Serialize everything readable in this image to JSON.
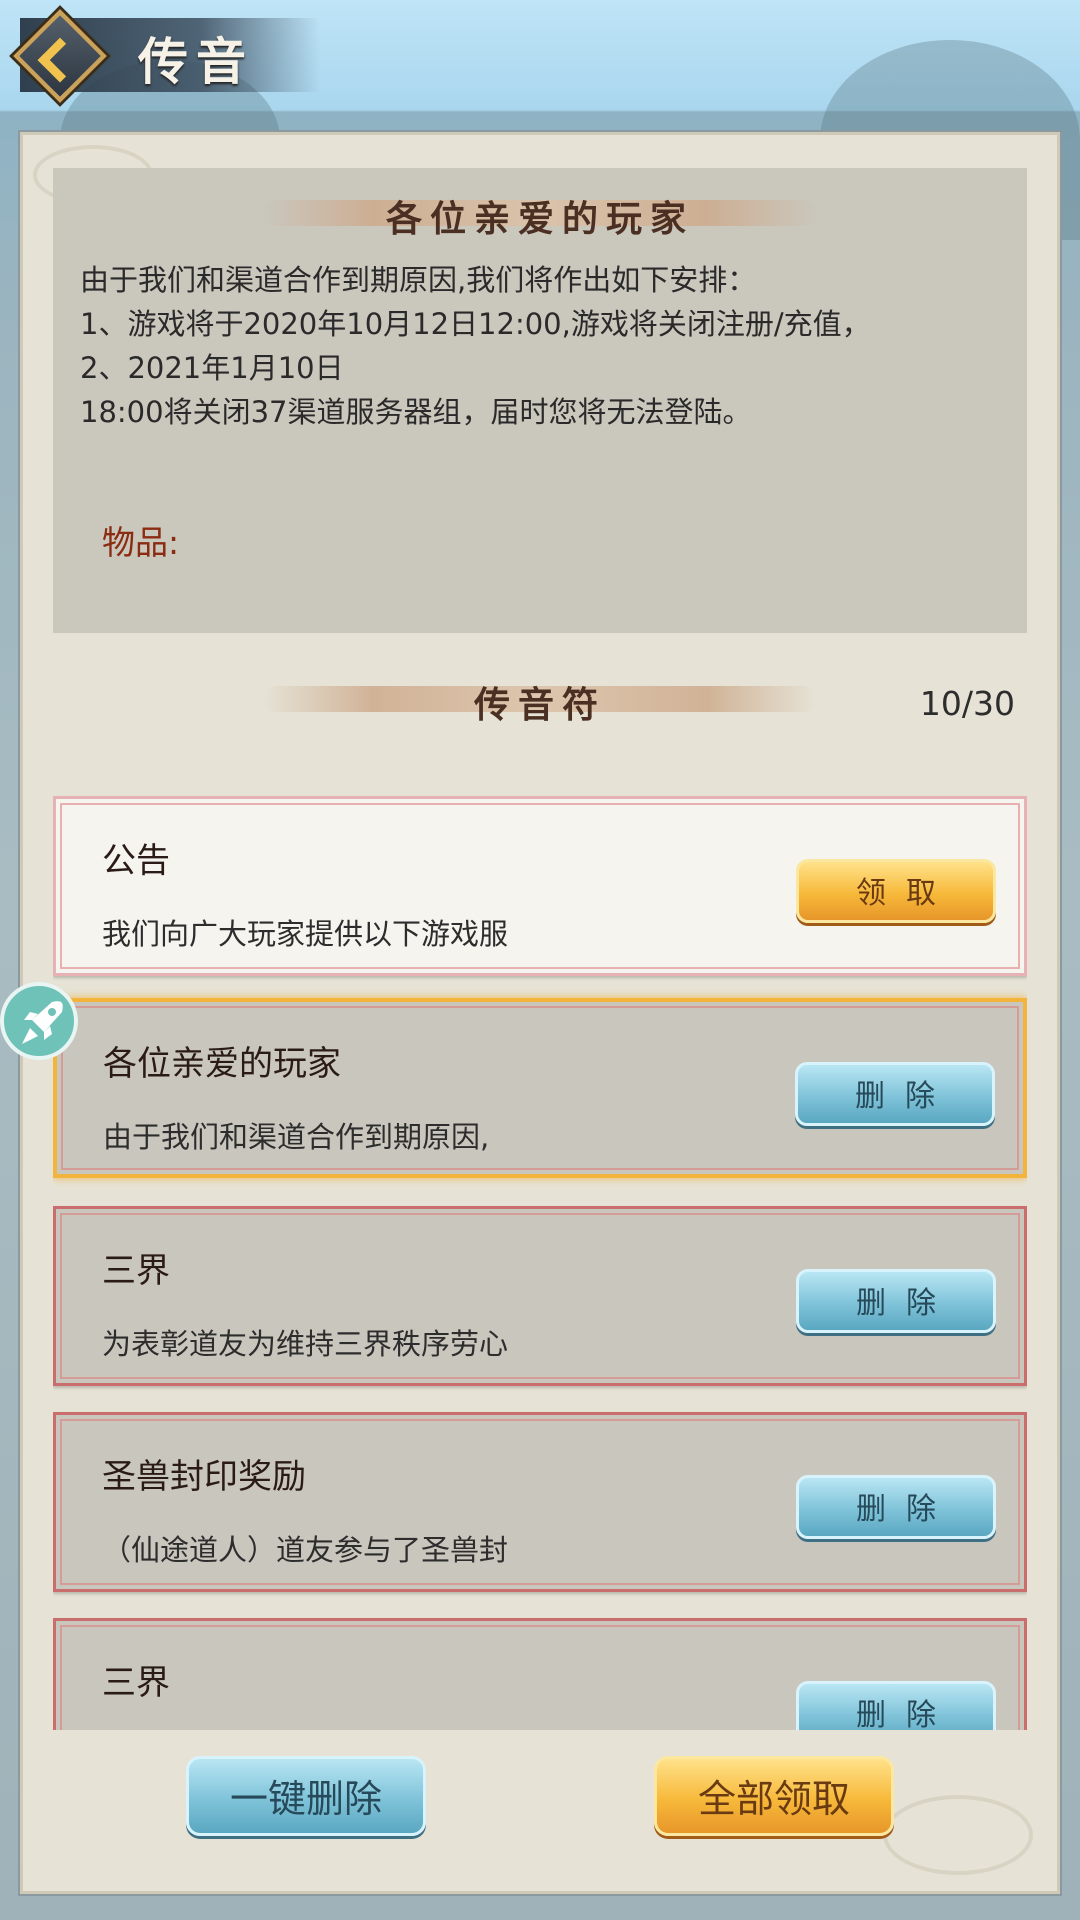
{
  "header": {
    "title": "传音"
  },
  "detail": {
    "heading": "各位亲爱的玩家",
    "body": "由于我们和渠道合作到期原因,我们将作出如下安排：\n1、游戏将于2020年10月12日12:00,游戏将关闭注册/充值，\n2、2021年1月10日\n18:00将关闭37渠道服务器组，届时您将无法登陆。",
    "items_label": "物品:"
  },
  "list": {
    "heading": "传音符",
    "count": "10/30",
    "messages": [
      {
        "title": "公告",
        "preview": "我们向广大玩家提供以下游戏服",
        "action": "领取"
      },
      {
        "title": "各位亲爱的玩家",
        "preview": "由于我们和渠道合作到期原因,",
        "action": "删除"
      },
      {
        "title": "三界",
        "preview": "为表彰道友为维持三界秩序劳心",
        "action": "删除"
      },
      {
        "title": "圣兽封印奖励",
        "preview": "（仙途道人）道友参与了圣兽封",
        "action": "删除"
      },
      {
        "title": "三界",
        "preview": "",
        "action": "删除"
      }
    ]
  },
  "footer": {
    "delete_all": "一键删除",
    "claim_all": "全部领取"
  },
  "colors": {
    "gold": "#f7b93a",
    "blue": "#7fc3d9",
    "selected_border": "#f2b43c",
    "item_label": "#8a2b12"
  },
  "icons": {
    "back": "chevron-left-icon",
    "float": "rocket-icon"
  }
}
